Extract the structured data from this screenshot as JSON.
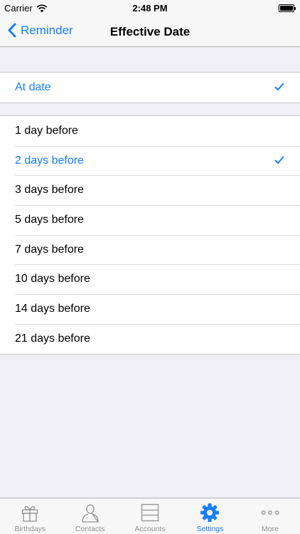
{
  "status_bar": {
    "carrier": "Carrier",
    "time": "2:48 PM"
  },
  "nav": {
    "back_label": "Reminder",
    "title": "Effective Date"
  },
  "options": {
    "top": {
      "label": "At date",
      "selected": true
    },
    "items": [
      {
        "label": "1 day before",
        "selected": false
      },
      {
        "label": "2 days before",
        "selected": true
      },
      {
        "label": "3 days before",
        "selected": false
      },
      {
        "label": "5 days before",
        "selected": false
      },
      {
        "label": "7 days before",
        "selected": false
      },
      {
        "label": "10 days before",
        "selected": false
      },
      {
        "label": "14 days before",
        "selected": false
      },
      {
        "label": "21 days before",
        "selected": false
      }
    ]
  },
  "tabbar": {
    "tabs": [
      {
        "label": "Birthdays",
        "icon": "gift-icon",
        "active": false
      },
      {
        "label": "Contacts",
        "icon": "person-icon",
        "active": false
      },
      {
        "label": "Accounts",
        "icon": "accounts-icon",
        "active": false
      },
      {
        "label": "Settings",
        "icon": "gear-icon",
        "active": true
      },
      {
        "label": "More",
        "icon": "more-icon",
        "active": false
      }
    ]
  },
  "colors": {
    "accent": "#157efb",
    "background": "#efeff4",
    "inactive_tab": "#929292"
  }
}
